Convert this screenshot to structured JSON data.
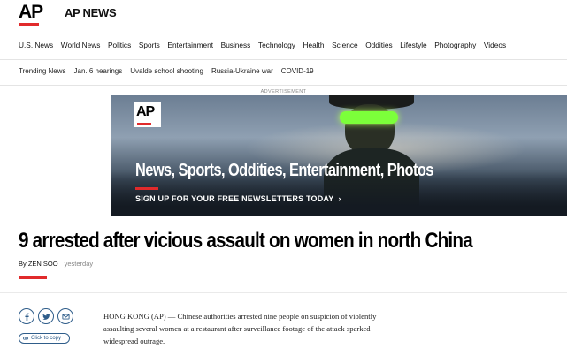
{
  "header": {
    "logo_text": "AP",
    "brand": "AP NEWS"
  },
  "nav_primary": [
    "U.S. News",
    "World News",
    "Politics",
    "Sports",
    "Entertainment",
    "Business",
    "Technology",
    "Health",
    "Science",
    "Oddities",
    "Lifestyle",
    "Photography",
    "Videos"
  ],
  "nav_trending": [
    "Trending News",
    "Jan. 6 hearings",
    "Uvalde school shooting",
    "Russia-Ukraine war",
    "COVID-19"
  ],
  "ad": {
    "label": "ADVERTISEMENT",
    "logo_text": "AP",
    "headline": "News, Sports, Oddities, Entertainment, Photos",
    "cta": "SIGN UP FOR YOUR FREE NEWSLETTERS TODAY",
    "cta_arrow": "›"
  },
  "article": {
    "title": "9 arrested after vicious assault on women in north China",
    "byline": "By ZEN SOO",
    "timestamp": "yesterday",
    "body_lines": [
      "HONG KONG (AP) — Chinese authorities arrested nine people on suspicion of violently",
      "assaulting several women at a restaurant after surveillance footage of the attack sparked",
      "widespread outrage."
    ]
  },
  "share": {
    "icons": [
      "facebook-icon",
      "twitter-icon",
      "email-icon"
    ],
    "copy_label": "Click to copy"
  },
  "colors": {
    "accent_red": "#e12a2b",
    "share_blue": "#2f5d8a"
  }
}
